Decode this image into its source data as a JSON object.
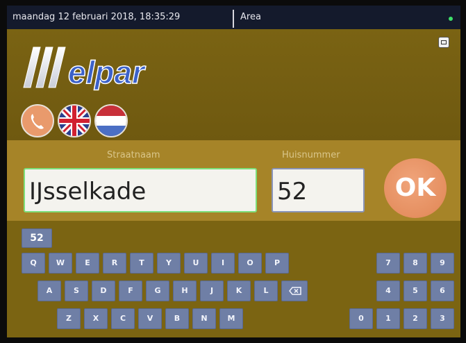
{
  "status_bar": {
    "datetime": "maandag 12 februari 2018, 18:35:29",
    "area": "Area",
    "status_color": "#3ee06a"
  },
  "header": {
    "logo_text": "elpar",
    "exit_icon": "exit-icon",
    "language_buttons": [
      "phone-icon",
      "uk-flag-icon",
      "nl-flag-icon"
    ]
  },
  "form": {
    "street_label": "Straatnaam",
    "street_value": "IJsselkade",
    "number_label": "Huisnummer",
    "number_value": "52",
    "ok_label": "OK"
  },
  "keyboard": {
    "suggestion": "52",
    "row1": [
      "Q",
      "W",
      "E",
      "R",
      "T",
      "Y",
      "U",
      "I",
      "O",
      "P"
    ],
    "row2": [
      "A",
      "S",
      "D",
      "F",
      "G",
      "H",
      "J",
      "K",
      "L"
    ],
    "row3": [
      "Z",
      "X",
      "C",
      "V",
      "B",
      "N",
      "M"
    ],
    "backspace_icon": "backspace-icon",
    "numpad_rows": [
      [
        "7",
        "8",
        "9"
      ],
      [
        "4",
        "5",
        "6"
      ],
      [
        "1",
        "2",
        "3"
      ]
    ],
    "zero": "0"
  },
  "colors": {
    "accent_ok": "#e58f60",
    "key_bg": "#6f7fa6",
    "panel_bg": "#a68428"
  }
}
